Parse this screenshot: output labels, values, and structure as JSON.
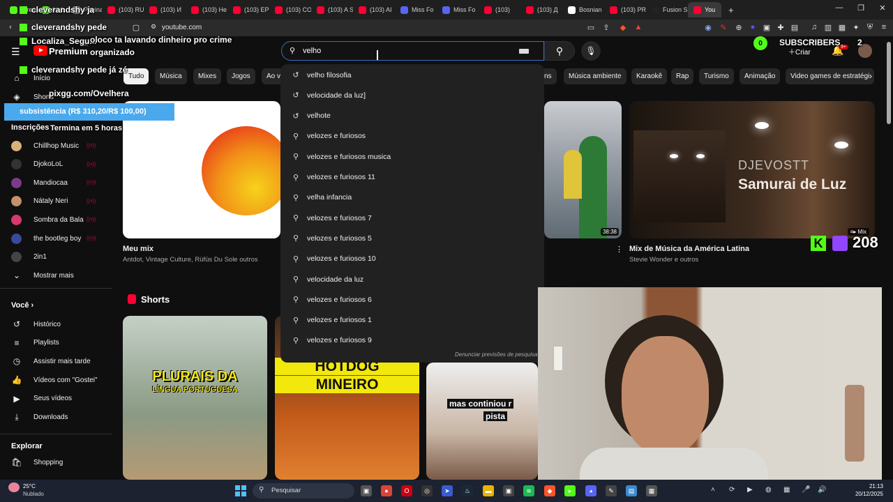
{
  "browser": {
    "tabs": [
      {
        "label": "Stream",
        "color": "#53fc18"
      },
      {
        "label": "kick.com",
        "color": "#53fc18"
      },
      {
        "label": "Página I",
        "color": "#888888"
      },
      {
        "label": "(103) RU",
        "color": "#ff0033"
      },
      {
        "label": "(103) И",
        "color": "#ff0033"
      },
      {
        "label": "(103) He",
        "color": "#ff0033"
      },
      {
        "label": "(103) EP",
        "color": "#ff0033"
      },
      {
        "label": "(103) CO",
        "color": "#ff0033"
      },
      {
        "label": "(103) A S",
        "color": "#ff0033"
      },
      {
        "label": "(103) AI",
        "color": "#ff0033"
      },
      {
        "label": "Miss Fo",
        "color": "#5865f2"
      },
      {
        "label": "Miss Fo",
        "color": "#5865f2"
      },
      {
        "label": "(103)",
        "color": "#ff0033"
      },
      {
        "label": "(103) Д",
        "color": "#ff0033"
      },
      {
        "label": "Bosnian",
        "color": "#ffffff"
      },
      {
        "label": "(103) PR",
        "color": "#ff0033"
      },
      {
        "label": "Fusion S",
        "color": "#222222"
      },
      {
        "label": "You",
        "color": "#ff0033",
        "active": true
      }
    ],
    "new_tab": "+",
    "url": "youtube.com"
  },
  "youtube": {
    "logo_text": "Premium",
    "logo_region": "BR",
    "search_value": "velho",
    "create_label": "Criar",
    "notif_count": "9+",
    "chips": [
      "Tudo",
      "Música",
      "Mixes",
      "Jogos",
      "Ao vi",
      "ns",
      "Música ambiente",
      "Karaokê",
      "Rap",
      "Turismo",
      "Animação",
      "Video games de estratégi"
    ],
    "sidebar": {
      "home": "Início",
      "shorts": "Shorts",
      "subs_heading": "Inscrições",
      "channels": [
        "Chillhop Music",
        "DjokoLoL",
        "Mandiocaa",
        "Nátaly Neri",
        "Sombra da Bala",
        "the bootleg boy",
        "2in1"
      ],
      "show_more": "Mostrar mais",
      "you_heading": "Você",
      "you_items": [
        "Histórico",
        "Playlists",
        "Assistir mais tarde",
        "Vídeos com \"Gostei\"",
        "Seus vídeos",
        "Downloads"
      ],
      "explore_heading": "Explorar",
      "explore_items": [
        "Shopping"
      ]
    },
    "suggestions": [
      {
        "text": "velho filosofia",
        "icon": "history-icon"
      },
      {
        "text": "velocidade da luz]",
        "icon": "history-icon"
      },
      {
        "text": "velhote",
        "icon": "history-icon"
      },
      {
        "text": "velozes e furiosos",
        "icon": "search-icon"
      },
      {
        "text": "velozes e furiosos musica",
        "icon": "search-icon"
      },
      {
        "text": "velozes e furiosos 11",
        "icon": "search-icon"
      },
      {
        "text": "velha infancia",
        "icon": "search-icon"
      },
      {
        "text": "velozes e furiosos 7",
        "icon": "search-icon"
      },
      {
        "text": "velozes e furiosos 5",
        "icon": "search-icon"
      },
      {
        "text": "velozes e furiosos 10",
        "icon": "search-icon"
      },
      {
        "text": "velocidade da luz",
        "icon": "search-icon"
      },
      {
        "text": "velozes e furiosos 6",
        "icon": "search-icon"
      },
      {
        "text": "velozes e furiosos 1",
        "icon": "search-icon"
      },
      {
        "text": "velozes e furiosos 9",
        "icon": "search-icon"
      }
    ],
    "report_predictions": "Denunciar previsões de pesquisa",
    "videos": {
      "mix1": {
        "title": "Meu mix",
        "meta": "Antdot, Vintage Culture, Rüfüs Du Sole outros"
      },
      "mid": {
        "duration": "38:38"
      },
      "mix2": {
        "title": "Mix de Música da América Latina",
        "meta": "Stevie Wonder e outros",
        "thumb_line1": "DJEVOSTT",
        "thumb_line2": "Samurai de Luz",
        "badge": "Mix"
      }
    },
    "shorts_heading": "Shorts",
    "shorts": [
      {
        "line1": "PLURAIS DA",
        "line2": "LÍNGUA PORTUGUESA"
      },
      {
        "line1": "HOTDOG",
        "line2": "MINEIRO"
      },
      {
        "line1": "mas continiou r",
        "line2": "pista"
      }
    ]
  },
  "overlay": {
    "chat": [
      {
        "user": "cleverandshy",
        "msg": "ja"
      },
      {
        "user": "cleverandshy",
        "msg": "pede"
      },
      {
        "user": "Localiza_Segu...",
        "msg": "oloco ta lavando dinheiro pro crime organizado"
      },
      {
        "user": "cleverandshy",
        "msg": "pede já zé"
      }
    ],
    "pix": "pixgg.com/Ovelhera",
    "goal": "subsistência (R$ 310,20/R$ 100,00)",
    "ends": "Termina em 5 horas",
    "subs_count": "0",
    "subs_label": "SUBSCRIBERS",
    "subs_number": "2",
    "viewers": "208"
  },
  "taskbar": {
    "weather_temp": "25°C",
    "weather_desc": "Nublado",
    "search": "Pesquisar",
    "time": "21:13",
    "date": "20/12/2025"
  }
}
